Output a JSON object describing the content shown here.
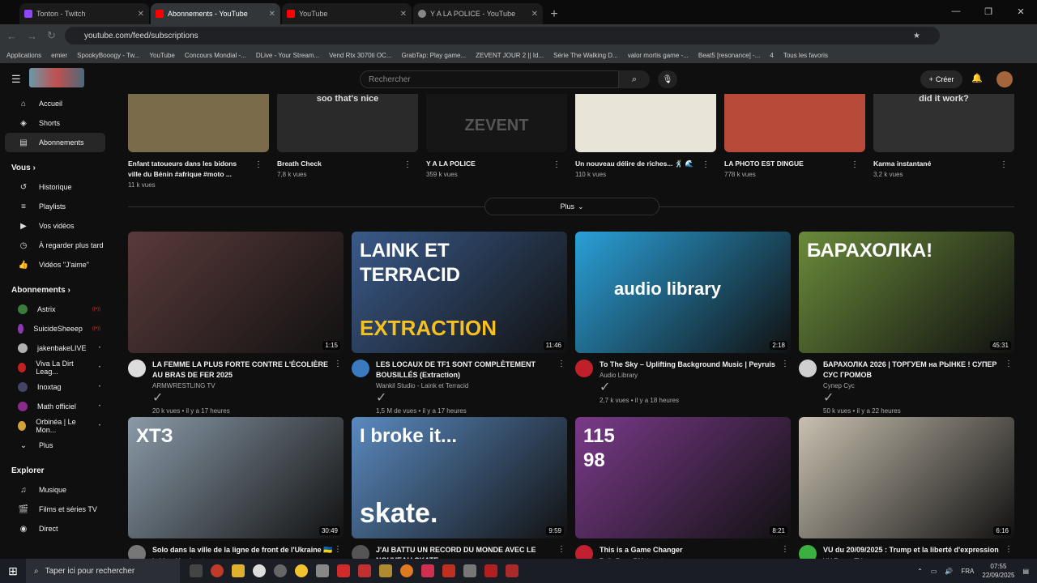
{
  "browser": {
    "tabs": [
      {
        "label": "Tonton - Twitch",
        "color": "#9146ff"
      },
      {
        "label": "Abonnements - YouTube",
        "color": "#ff0000"
      },
      {
        "label": "YouTube",
        "color": "#ff0000"
      },
      {
        "label": "Y A LA POLICE - YouTube",
        "color": "#888888"
      }
    ],
    "url": "youtube.com/feed/subscriptions",
    "bookmarks": [
      "Applications",
      "emier",
      "SpookyBooogy - Tw...",
      "YouTube",
      "Concours Mondial -...",
      "DLive - Your Stream...",
      "Vend Rtx 3070ti OC...",
      "GrabTap: Play game...",
      "ZEVENT JOUR 2 || Id...",
      "Série The Walking D...",
      "valor mortis game -...",
      "Beat5 [resonance] -...",
      "4",
      "Tous les favoris"
    ]
  },
  "youtube": {
    "search_placeholder": "Rechercher",
    "create_label": "Créer"
  },
  "sidebar": {
    "main": [
      {
        "label": "Accueil",
        "icon": "home-icon",
        "glyph": "⌂"
      },
      {
        "label": "Shorts",
        "icon": "shorts-icon",
        "glyph": "◈"
      },
      {
        "label": "Abonnements",
        "icon": "subscriptions-icon",
        "glyph": "▤"
      }
    ],
    "you_header": "Vous",
    "you": [
      {
        "label": "Historique",
        "icon": "history-icon",
        "glyph": "↺"
      },
      {
        "label": "Playlists",
        "icon": "playlists-icon",
        "glyph": "≡"
      },
      {
        "label": "Vos vidéos",
        "icon": "your-videos-icon",
        "glyph": "▶"
      },
      {
        "label": "À regarder plus tard",
        "icon": "watch-later-icon",
        "glyph": "◷"
      },
      {
        "label": "Vidéos \"J'aime\"",
        "icon": "like-icon",
        "glyph": "👍"
      }
    ],
    "subs_header": "Abonnements",
    "subs": [
      {
        "label": "Astrix",
        "color": "#3a7d3a",
        "live": true
      },
      {
        "label": "SuicideSheeep",
        "color": "#8a3ab0",
        "live": true
      },
      {
        "label": "jakenbakeLIVE",
        "color": "#b0b0b0",
        "live": false
      },
      {
        "label": "Viva La Dirt Leag...",
        "color": "#c02020",
        "live": false
      },
      {
        "label": "Inoxtag",
        "color": "#446",
        "live": false
      },
      {
        "label": "Math officiel",
        "color": "#8a2a8a",
        "live": false
      },
      {
        "label": "Orbinéa | Le Mon...",
        "color": "#d4a23a",
        "live": false
      },
      {
        "label": "Plus",
        "color": "",
        "live": false
      }
    ],
    "explore_header": "Explorer",
    "explore": [
      {
        "label": "Musique",
        "icon": "music-icon",
        "glyph": "♫"
      },
      {
        "label": "Films et séries TV",
        "icon": "movies-icon",
        "glyph": "🎬"
      },
      {
        "label": "Direct",
        "icon": "live-icon",
        "glyph": "◉"
      }
    ]
  },
  "shorts": [
    {
      "title": "Enfant tatoueurs dans les bidons ville du Bénin #afrique #moto ...",
      "views": "11 k vues",
      "color": "#7a6b4a"
    },
    {
      "title": "Breath Check",
      "views": "7,8 k vues",
      "color": "#2a2a2a",
      "caption": "soo that's nice"
    },
    {
      "title": "Y A LA POLICE",
      "views": "359 k vues",
      "color": "#161616",
      "caption": "ZEVENT"
    },
    {
      "title": "Un nouveau délire de riches... 🕺 🌊",
      "views": "110 k vues",
      "color": "#e8e4d8"
    },
    {
      "title": "LA PHOTO EST DINGUE",
      "views": "778 k vues",
      "color": "#b84a3a"
    },
    {
      "title": "Karma instantané",
      "views": "3,2 k vues",
      "color": "#303030",
      "caption": "did it work?"
    }
  ],
  "more_label": "Plus",
  "videos": [
    {
      "title": "LA FEMME LA PLUS FORTE CONTRE L'ÉCOLIÈRE AU BRAS DE FER 2025",
      "channel": "ARMWRESTLING TV",
      "verified": true,
      "meta": "20 k vues • il y a 17 heures",
      "duration": "1:15",
      "color": "#5a3a3a",
      "avatar": "#ddd"
    },
    {
      "title": "LES LOCAUX DE TF1 SONT COMPLÈTEMENT BOUSILLÉS (Extraction)",
      "channel": "Wankil Studio - Laink et Terracid",
      "verified": true,
      "meta": "1,5 M de vues • il y a 17 heures",
      "duration": "11:46",
      "color": "#3a5a8a",
      "avatar": "#3a7ac0",
      "overlay1": "LAINK ET",
      "overlay2": "TERRACID",
      "overlay3": "EXTRACTION"
    },
    {
      "title": "To The Sky – Uplifting Background Music | Peyruis",
      "channel": "Audio Library",
      "verified": true,
      "meta": "2,7 k vues • il y a 18 heures",
      "duration": "2:18",
      "color": "#2aa0d8",
      "avatar": "#c0202a",
      "overlay1": "audio library"
    },
    {
      "title": "БАРАХОЛКА 2026 | ТОРГУЕМ на РЫНКЕ ! СУПЕР СУС ГРОМОВ",
      "channel": "Супер Сус",
      "verified": true,
      "meta": "50 k vues • il y a 22 heures",
      "duration": "45:31",
      "color": "#6a8a3a",
      "avatar": "#cfcfcf",
      "overlay1": "БАРАХОЛКА!"
    },
    {
      "title": "Solo dans la ville de la ligne de front de l'Ukraine 🇺🇦",
      "channel": "bald and bankrupt",
      "verified": true,
      "meta": "",
      "duration": "30:49",
      "color": "#8a9aa8",
      "avatar": "#777",
      "overlay1": "ХТЗ"
    },
    {
      "title": "J'AI BATTU UN RECORD DU MONDE AVEC LE NOUVEAU SKATE",
      "channel": "",
      "verified": false,
      "meta": "",
      "duration": "9:59",
      "color": "#5a8ac0",
      "avatar": "#555",
      "overlay1": "I broke it...",
      "overlay2": "skate."
    },
    {
      "title": "This is a Game Changer",
      "channel": "Daily Dose Of Internet",
      "verified": true,
      "meta": "",
      "duration": "8:21",
      "color": "#7a3a8a",
      "avatar": "#c02030",
      "overlay1": "115",
      "overlay2": "98"
    },
    {
      "title": "VU du 20/09/2025 : Trump et la liberté d'expression",
      "channel": "VU FranceTV",
      "verified": true,
      "meta": "",
      "duration": "6:16",
      "color": "#c8c0b0",
      "avatar": "#3ab040"
    }
  ],
  "taskbar": {
    "search": "Taper ici pour rechercher",
    "lang": "FRA",
    "time": "07:55",
    "date": "22/09/2025"
  }
}
